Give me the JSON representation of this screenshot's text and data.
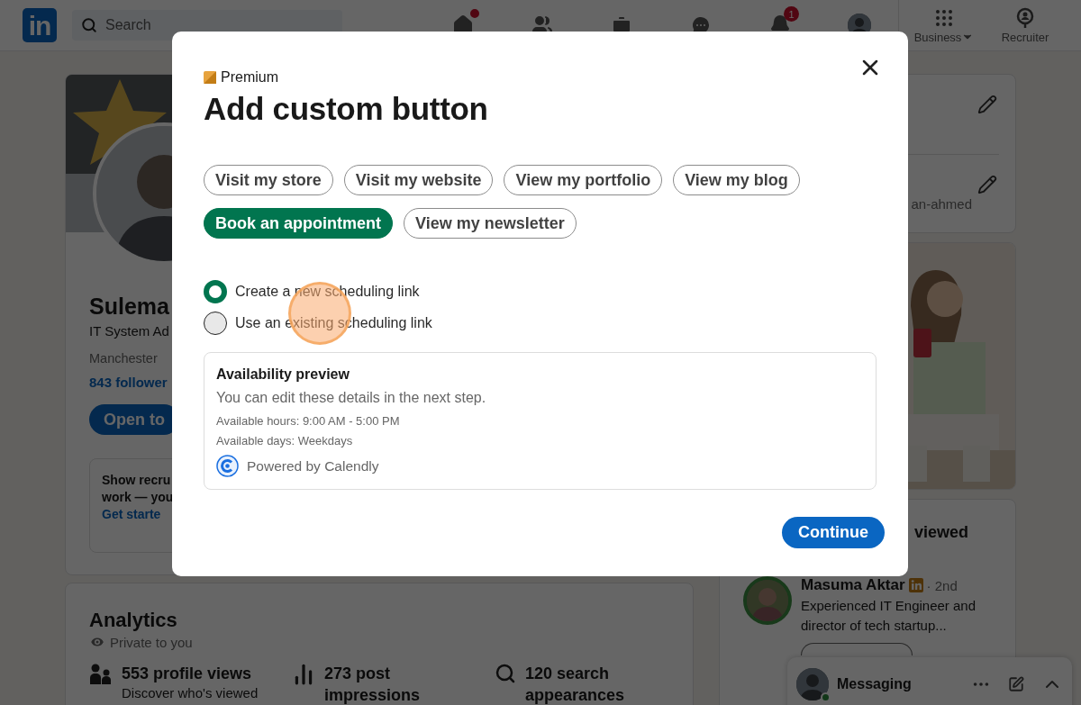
{
  "nav": {
    "logo": "in",
    "search": {
      "placeholder": "Search"
    },
    "icons": [
      {
        "kind": "home",
        "dot": true
      },
      {
        "kind": "network",
        "dot": false
      },
      {
        "kind": "jobs",
        "dot": false
      },
      {
        "kind": "messaging",
        "dot": false
      },
      {
        "kind": "notifications",
        "dot": false,
        "badge": "1"
      },
      {
        "kind": "avatar",
        "dot": false
      }
    ],
    "apps": [
      {
        "kind": "grid",
        "label": "Business",
        "menu": true
      },
      {
        "kind": "recruiter",
        "label": "Recruiter",
        "menu": false
      }
    ]
  },
  "profile": {
    "name": "Sulema",
    "headline": "IT System Ad",
    "location": "Manchester",
    "followers": "843 follower",
    "open_button": "Open to",
    "prompt": {
      "line_1": "Show recru",
      "line_2": "work — you",
      "link": "Get starte"
    }
  },
  "analytics": {
    "title": "Analytics",
    "privacy": "Private to you",
    "stats": [
      {
        "kind": "people",
        "title": "553 profile views",
        "subtitle": "Discover who's viewed"
      },
      {
        "kind": "chart",
        "title": "273 post impressions"
      },
      {
        "kind": "search",
        "title": "120 search appearances"
      }
    ]
  },
  "settings": {
    "url_fragment": "an-ahmed"
  },
  "viewers": {
    "title": "viewed",
    "people": [
      {
        "name": "Masuma Aktar",
        "degree": "· 2nd",
        "headline": "Experienced IT Engineer and director of tech startup...",
        "open_to_work": true
      }
    ]
  },
  "messaging": {
    "title": "Messaging",
    "online": true
  },
  "modal": {
    "badge": "Premium",
    "title": "Add custom button",
    "options": [
      {
        "label": "Visit my store",
        "selected": false
      },
      {
        "label": "Visit my website",
        "selected": false
      },
      {
        "label": "View my portfolio",
        "selected": false
      },
      {
        "label": "View my blog",
        "selected": false
      },
      {
        "label": "Book an appointment",
        "selected": true
      },
      {
        "label": "View my newsletter",
        "selected": false
      }
    ],
    "link_choices": [
      {
        "label": "Create a new scheduling link",
        "selected": true
      },
      {
        "label": "Use an existing scheduling link",
        "selected": false
      }
    ],
    "preview": {
      "title": "Availability preview",
      "note": "You can edit these details in the next step.",
      "hours": "Available hours: 9:00 AM - 5:00 PM",
      "days": "Available days: Weekdays",
      "provider": "Powered by Calendly"
    },
    "primary_button": "Continue"
  },
  "click_marker": {
    "visible": true
  }
}
